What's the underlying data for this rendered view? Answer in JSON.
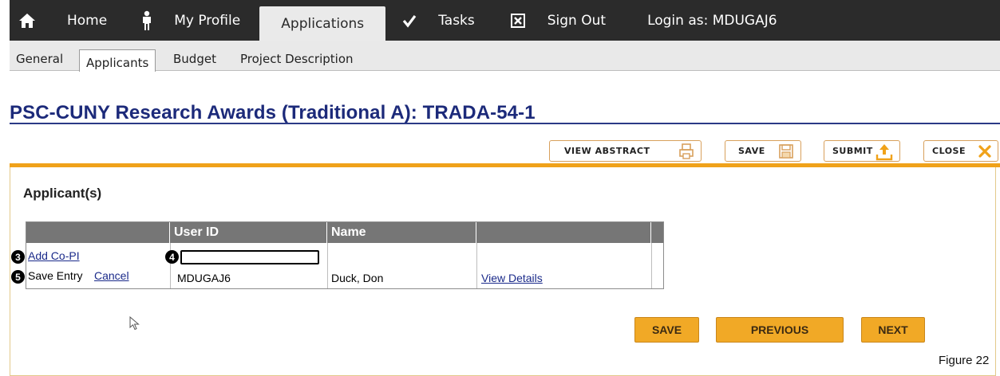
{
  "nav": {
    "home": "Home",
    "profile": "My Profile",
    "applications": "Applications",
    "tasks": "Tasks",
    "signout": "Sign Out",
    "login_as": "Login as: MDUGAJ6",
    "icons": [
      "house-icon",
      "person-icon",
      "checkmark-icon",
      "x-box-icon"
    ]
  },
  "subnav": {
    "tabs": [
      "General",
      "Applicants",
      "Budget",
      "Project Description"
    ],
    "active": "Applicants"
  },
  "title": "PSC-CUNY Research Awards (Traditional A): TRADA-54-1",
  "actions": {
    "view_abstract": "VIEW ABSTRACT",
    "save": "SAVE",
    "submit": "SUBMIT",
    "close": "CLOSE"
  },
  "section": {
    "title": "Applicant(s)"
  },
  "table": {
    "headers": [
      "",
      "User ID",
      "Name",
      ""
    ],
    "add_copi": "Add Co-PI",
    "save_entry": "Save Entry",
    "cancel": "Cancel",
    "row": {
      "user_id": "MDUGAJ6",
      "name": "Duck, Don",
      "view_details": "View Details"
    },
    "input_value": ""
  },
  "callouts": {
    "c3": "3",
    "c4": "4",
    "c5": "5"
  },
  "buttons": {
    "save": "SAVE",
    "previous": "PREVIOUS",
    "next": "NEXT"
  },
  "figure_label": "Figure 22",
  "colors": {
    "nav_bg": "#2b2b2b",
    "title": "#1c2a7a",
    "accent": "#f0a21a",
    "header": "#767676",
    "link": "#1a2a8a"
  }
}
